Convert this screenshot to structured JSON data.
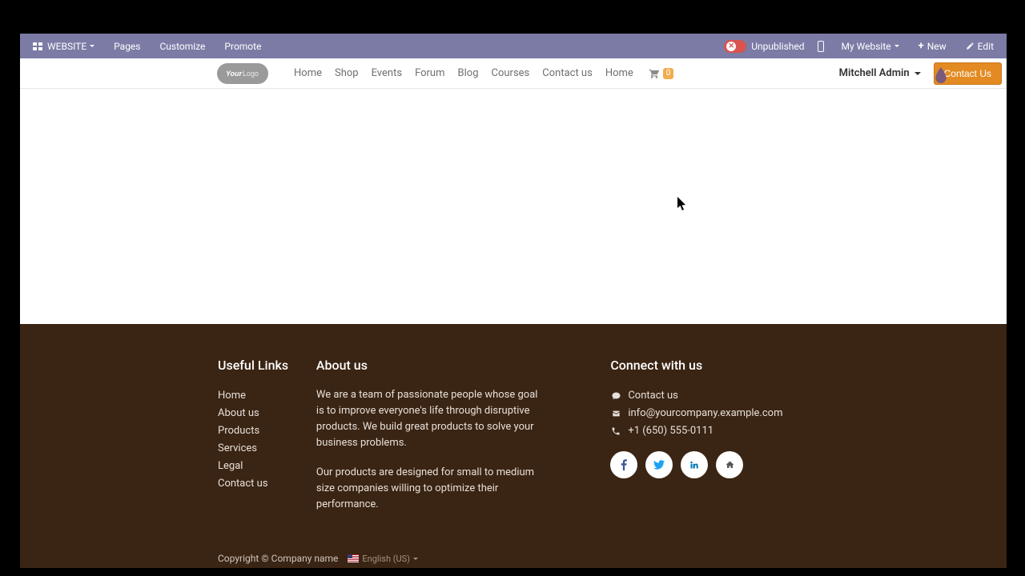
{
  "topbar": {
    "website_label": "WEBSITE",
    "pages": "Pages",
    "customize": "Customize",
    "promote": "Promote",
    "unpublished": "Unpublished",
    "my_website": "My Website",
    "new": "New",
    "edit": "Edit"
  },
  "nav": {
    "items": [
      "Home",
      "Shop",
      "Events",
      "Forum",
      "Blog",
      "Courses",
      "Contact us",
      "Home"
    ],
    "cart_count": "0",
    "user_name": "Mitchell Admin",
    "cta": "Contact Us"
  },
  "footer": {
    "useful_links_title": "Useful Links",
    "useful_links": [
      "Home",
      "About us",
      "Products",
      "Services",
      "Legal",
      "Contact us"
    ],
    "about_title": "About us",
    "about_p1": "We are a team of passionate people whose goal is to improve everyone's life through disruptive products. We build great products to solve your business problems.",
    "about_p2": "Our products are designed for small to medium size companies willing to optimize their performance.",
    "connect_title": "Connect with us",
    "contact_us": "Contact us",
    "email": "info@yourcompany.example.com",
    "phone": "+1 (650) 555-0111"
  },
  "bottom": {
    "copyright": "Copyright © Company name",
    "language": "English (US)"
  }
}
